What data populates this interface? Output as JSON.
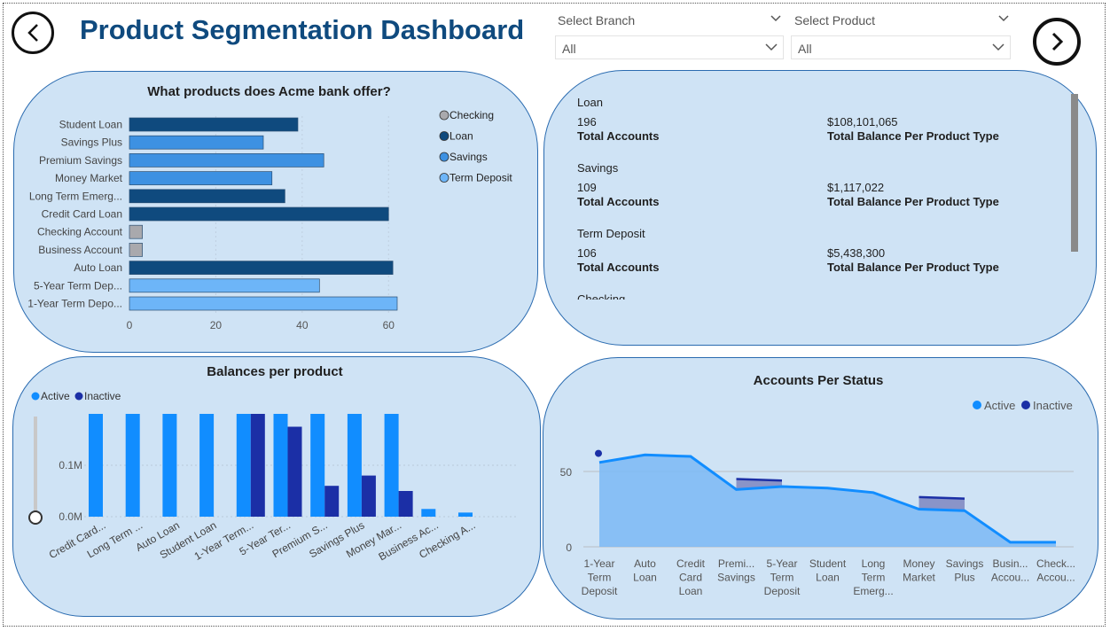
{
  "header": {
    "title": "Product Segmentation Dashboard",
    "branch_label": "Select Branch",
    "branch_value": "All",
    "product_label": "Select Product",
    "product_value": "All"
  },
  "kpi_panel": {
    "items": [
      {
        "product": "Loan",
        "accounts": "196",
        "accounts_label": "Total Accounts",
        "balance": "$108,101,065",
        "balance_label": "Total Balance Per Product Type"
      },
      {
        "product": "Savings",
        "accounts": "109",
        "accounts_label": "Total Accounts",
        "balance": "$1,117,022",
        "balance_label": "Total Balance Per Product Type"
      },
      {
        "product": "Term Deposit",
        "accounts": "106",
        "accounts_label": "Total Accounts",
        "balance": "$5,438,300",
        "balance_label": "Total Balance Per Product Type"
      },
      {
        "product": "Checking"
      }
    ]
  },
  "chart_data": [
    {
      "type": "bar",
      "orientation": "horizontal",
      "title": "What products does Acme bank offer?",
      "categories": [
        "Student Loan",
        "Savings Plus",
        "Premium Savings",
        "Money Market",
        "Long Term Emerg...",
        "Credit Card Loan",
        "Checking Account",
        "Business Account",
        "Auto Loan",
        "5-Year Term Dep...",
        "1-Year Term Depo..."
      ],
      "values": [
        39,
        31,
        45,
        33,
        36,
        60,
        3,
        3,
        61,
        44,
        62
      ],
      "category_type": [
        "Loan",
        "Savings",
        "Savings",
        "Savings",
        "Loan",
        "Loan",
        "Checking",
        "Checking",
        "Loan",
        "Term Deposit",
        "Term Deposit"
      ],
      "legend": [
        {
          "name": "Checking",
          "color": "#a9a9ad"
        },
        {
          "name": "Loan",
          "color": "#0f4a7e"
        },
        {
          "name": "Savings",
          "color": "#3d91e2"
        },
        {
          "name": "Term Deposit",
          "color": "#6db5f8"
        }
      ],
      "xticks": [
        "0",
        "20",
        "40",
        "60"
      ],
      "xlim": [
        0,
        62
      ],
      "legend_position": "right"
    },
    {
      "type": "bar",
      "title": "Balances per product",
      "categories": [
        "Credit Card...",
        "Long Term ...",
        "Auto Loan",
        "Student Loan",
        "1-Year Term...",
        "5-Year Ter...",
        "Premium S...",
        "Savings Plus",
        "Money Mar...",
        "Business Ac...",
        "Checking A..."
      ],
      "series": [
        {
          "name": "Active",
          "color": "#118dff",
          "values": [
            0.2,
            0.2,
            0.2,
            0.2,
            0.2,
            0.2,
            0.2,
            0.2,
            0.2,
            0.015,
            0.008
          ]
        },
        {
          "name": "Inactive",
          "color": "#1b2fa6",
          "values": [
            0,
            0,
            0,
            0,
            0.2,
            0.175,
            0.06,
            0.08,
            0.05,
            0,
            0
          ]
        }
      ],
      "yticks": [
        "0.0M",
        "0.1M"
      ],
      "ylim": [
        0,
        0.2
      ],
      "legend_position": "top-left"
    },
    {
      "type": "area",
      "title": "Accounts Per Status",
      "categories": [
        "1-Year\nTerm\nDeposit",
        "Auto\nLoan",
        "Credit\nCard\nLoan",
        "Premi...\nSavings",
        "5-Year\nTerm\nDeposit",
        "Student\nLoan",
        "Long\nTerm\nEmerg...",
        "Money\nMarket",
        "Savings\nPlus",
        "Busin...\nAccou...",
        "Check...\nAccou..."
      ],
      "series": [
        {
          "name": "Active",
          "color": "#118dff",
          "values": [
            56,
            61,
            60,
            38,
            40,
            39,
            36,
            25,
            24,
            3,
            3
          ]
        },
        {
          "name": "Inactive",
          "color": "#1b2fa6",
          "values": [
            62,
            null,
            null,
            45,
            44,
            null,
            null,
            33,
            32,
            null,
            null
          ]
        }
      ],
      "yticks": [
        "0",
        "50"
      ],
      "ylim": [
        0,
        70
      ],
      "legend_position": "top-right"
    }
  ]
}
